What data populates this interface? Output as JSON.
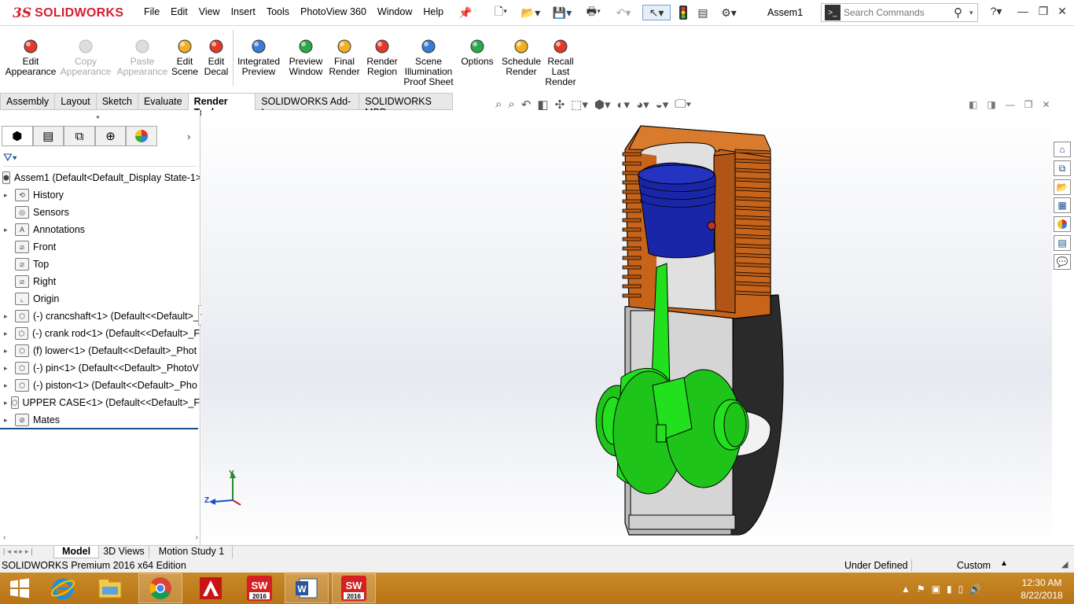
{
  "app": {
    "brand": "SOLIDWORKS",
    "document_title": "Assem1"
  },
  "menu": [
    "File",
    "Edit",
    "View",
    "Insert",
    "Tools",
    "PhotoView 360",
    "Window",
    "Help"
  ],
  "search": {
    "placeholder": "Search Commands"
  },
  "ribbon": [
    {
      "label": "Edit Appearance",
      "lines": [
        "Edit",
        "Appearance"
      ],
      "enabled": true,
      "icon": "edit-appearance-icon"
    },
    {
      "label": "Copy Appearance",
      "lines": [
        "Copy",
        "Appearance"
      ],
      "enabled": false,
      "icon": "copy-appearance-icon"
    },
    {
      "label": "Paste Appearance",
      "lines": [
        "Paste",
        "Appearance"
      ],
      "enabled": false,
      "icon": "paste-appearance-icon"
    },
    {
      "label": "Edit Scene",
      "lines": [
        "Edit",
        "Scene"
      ],
      "enabled": true,
      "icon": "edit-scene-icon"
    },
    {
      "label": "Edit Decal",
      "lines": [
        "Edit",
        "Decal"
      ],
      "enabled": true,
      "icon": "edit-decal-icon"
    },
    {
      "label": "Integrated Preview",
      "lines": [
        "Integrated",
        "Preview"
      ],
      "enabled": true,
      "icon": "integrated-preview-icon"
    },
    {
      "label": "Preview Window",
      "lines": [
        "Preview",
        "Window"
      ],
      "enabled": true,
      "icon": "preview-window-icon"
    },
    {
      "label": "Final Render",
      "lines": [
        "Final",
        "Render"
      ],
      "enabled": true,
      "icon": "final-render-icon"
    },
    {
      "label": "Render Region",
      "lines": [
        "Render",
        "Region"
      ],
      "enabled": true,
      "icon": "render-region-icon"
    },
    {
      "label": "Scene Illumination Proof Sheet",
      "lines": [
        "Scene",
        "Illumination",
        "Proof Sheet"
      ],
      "enabled": true,
      "icon": "proof-sheet-icon"
    },
    {
      "label": "Options",
      "lines": [
        "Options"
      ],
      "enabled": true,
      "icon": "options-icon"
    },
    {
      "label": "Schedule Render",
      "lines": [
        "Schedule",
        "Render"
      ],
      "enabled": true,
      "icon": "schedule-render-icon"
    },
    {
      "label": "Recall Last Render",
      "lines": [
        "Recall",
        "Last",
        "Render"
      ],
      "enabled": true,
      "icon": "recall-render-icon"
    }
  ],
  "tabs": [
    "Assembly",
    "Layout",
    "Sketch",
    "Evaluate",
    "Render Tools",
    "SOLIDWORKS Add-Ins",
    "SOLIDWORKS MBD"
  ],
  "active_tab": "Render Tools",
  "tree": {
    "root": "Assem1  (Default<Default_Display State-1>",
    "items": [
      {
        "label": "History",
        "expand": true,
        "icon": "history-icon"
      },
      {
        "label": "Sensors",
        "expand": false,
        "icon": "sensors-icon"
      },
      {
        "label": "Annotations",
        "expand": true,
        "icon": "annotations-icon"
      },
      {
        "label": "Front",
        "expand": false,
        "icon": "plane-icon"
      },
      {
        "label": "Top",
        "expand": false,
        "icon": "plane-icon"
      },
      {
        "label": "Right",
        "expand": false,
        "icon": "plane-icon"
      },
      {
        "label": "Origin",
        "expand": false,
        "icon": "origin-icon"
      },
      {
        "label": "(-) crancshaft<1> (Default<<Default>_",
        "expand": true,
        "icon": "part-icon"
      },
      {
        "label": "(-) crank rod<1> (Default<<Default>_F",
        "expand": true,
        "icon": "part-icon"
      },
      {
        "label": "(f) lower<1> (Default<<Default>_Phot",
        "expand": true,
        "icon": "part-icon"
      },
      {
        "label": "(-) pin<1> (Default<<Default>_PhotoV",
        "expand": true,
        "icon": "part-icon"
      },
      {
        "label": "(-) piston<1> (Default<<Default>_Pho",
        "expand": true,
        "icon": "part-icon"
      },
      {
        "label": "UPPER CASE<1> (Default<<Default>_F",
        "expand": true,
        "icon": "part-icon"
      },
      {
        "label": "Mates",
        "expand": true,
        "icon": "mates-icon"
      }
    ]
  },
  "bottom_tabs": [
    "Model",
    "3D Views",
    "Motion Study 1"
  ],
  "status": {
    "edition": "SOLIDWORKS Premium 2016 x64 Edition",
    "state": "Under Defined",
    "units": "Custom"
  },
  "clock": {
    "time": "12:30 AM",
    "date": "8/22/2018"
  },
  "taskbar_apps": [
    "start",
    "internet-explorer",
    "file-explorer",
    "chrome",
    "autocad",
    "solidworks-2016",
    "word",
    "solidworks-2016-active"
  ],
  "triad": {
    "y": "Y",
    "z": "Z"
  },
  "colors": {
    "accent": "#1a4d8c",
    "brand_red": "#d3202e",
    "taskbar": "#c07d1f",
    "part_green": "#22e01e",
    "piston_blue": "#1a26a8",
    "case_orange": "#c8641a"
  }
}
